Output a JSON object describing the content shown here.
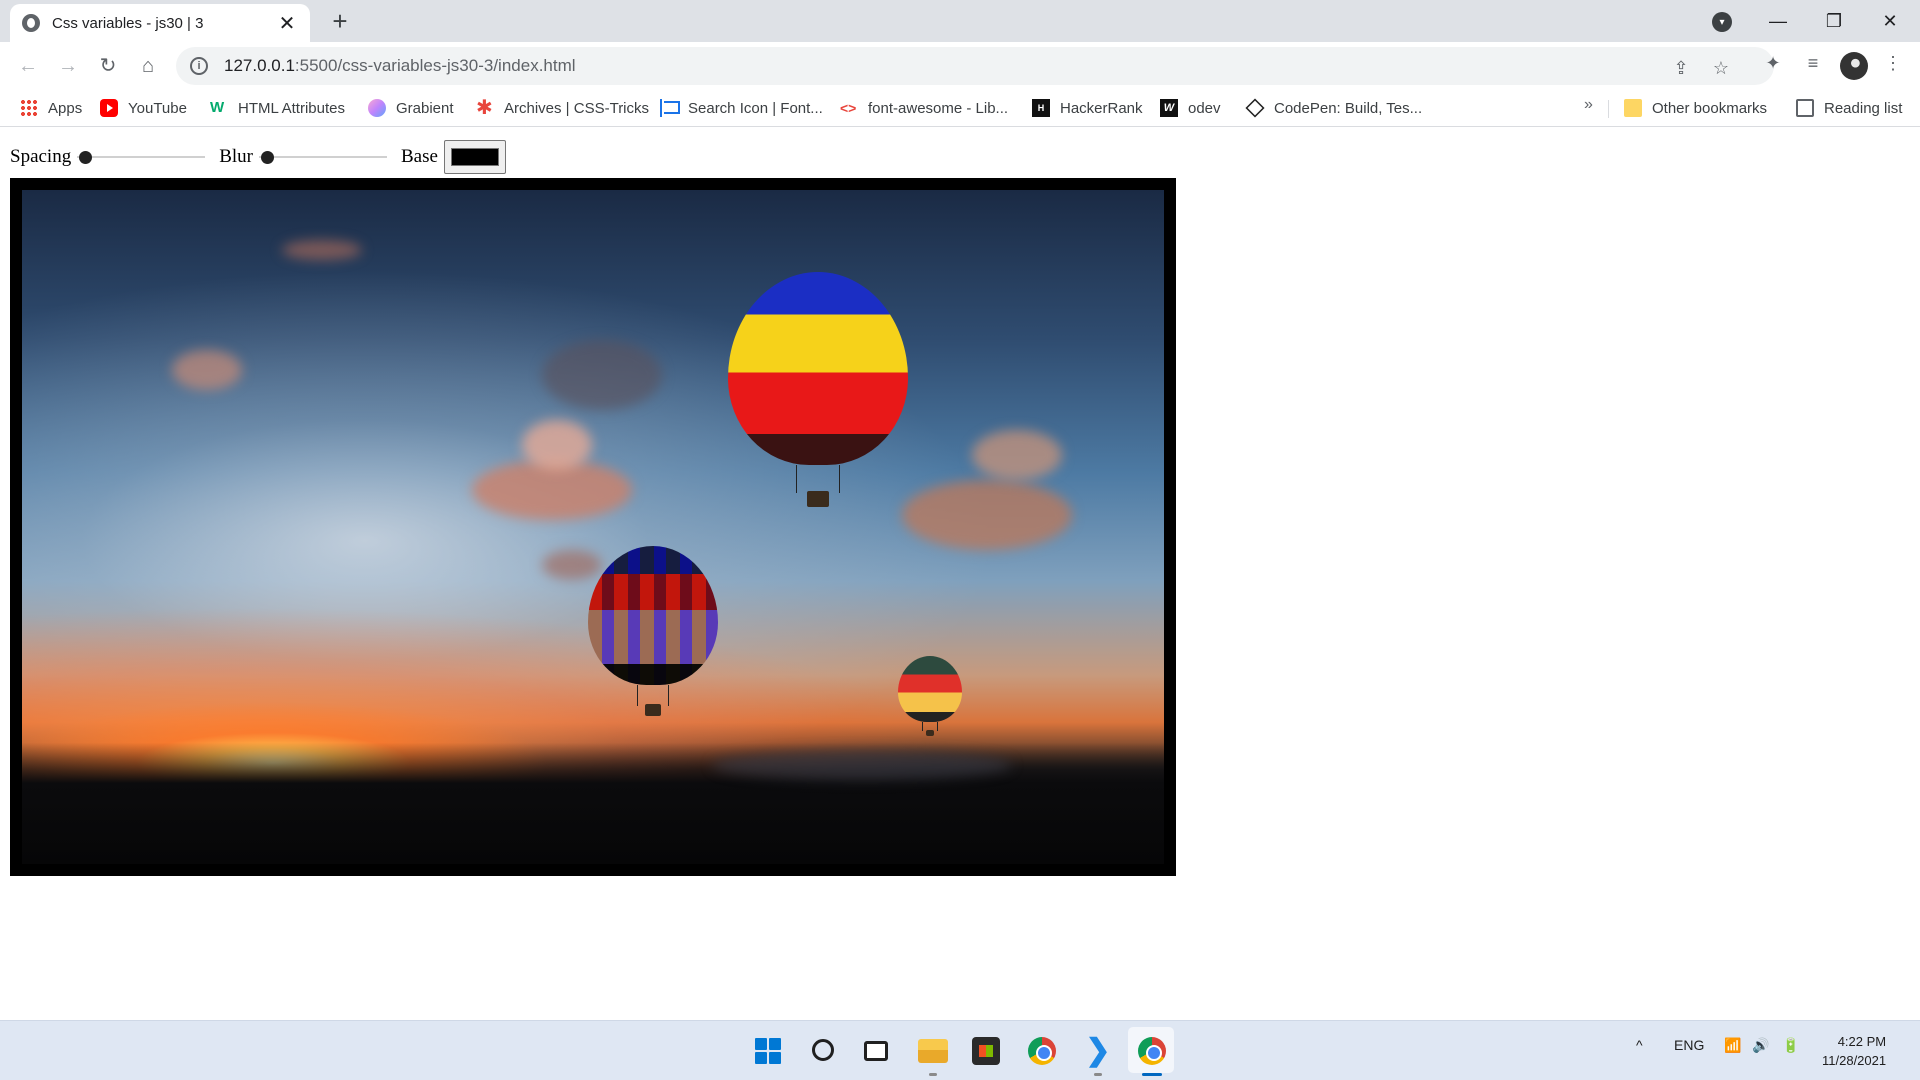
{
  "browser": {
    "tab": {
      "title": "Css variables - js30 | 3",
      "close": "✕"
    },
    "new_tab": "+",
    "window": {
      "minimize": "—",
      "restore": "❐",
      "close": "✕"
    },
    "url": {
      "host": "127.0.0.1",
      "rest": ":5500/css-variables-js30-3/index.html"
    },
    "nav": {
      "back": "←",
      "forward": "→",
      "reload": "↻",
      "home": "⌂"
    },
    "icons": {
      "share": "⇪",
      "star": "☆",
      "extensions": "✦",
      "media": "≡",
      "menu": "⋮"
    }
  },
  "bookmarks": [
    {
      "label": "Apps",
      "icon": "apps-grid-icon"
    },
    {
      "label": "YouTube",
      "icon": "youtube-icon"
    },
    {
      "label": "HTML Attributes",
      "icon": "w3schools-icon"
    },
    {
      "label": "Grabient",
      "icon": "grabient-icon"
    },
    {
      "label": "Archives | CSS-Tricks",
      "icon": "css-tricks-icon"
    },
    {
      "label": "Search Icon | Font...",
      "icon": "flag-icon"
    },
    {
      "label": "font-awesome - Lib...",
      "icon": "code-icon"
    },
    {
      "label": "HackerRank",
      "icon": "hackerrank-icon"
    },
    {
      "label": "odev",
      "icon": "odev-icon"
    },
    {
      "label": "CodePen: Build, Tes...",
      "icon": "codepen-icon"
    }
  ],
  "bookmarks_more": "»",
  "other_bookmarks": "Other bookmarks",
  "reading_list": "Reading list",
  "controls": {
    "spacing_label": "Spacing",
    "blur_label": "Blur",
    "base_label": "Base",
    "spacing_value": 0,
    "blur_value": 0,
    "base_color": "#000000"
  },
  "taskbar": {
    "tray_caret": "^",
    "lang": "ENG",
    "wifi": "📶",
    "volume": "🔊",
    "battery": "🔋",
    "time": "4:22 PM",
    "date": "11/28/2021"
  },
  "colors": {
    "tabstrip": "#dee1e6",
    "accent": "#1a73e8",
    "frame": "#000000"
  }
}
